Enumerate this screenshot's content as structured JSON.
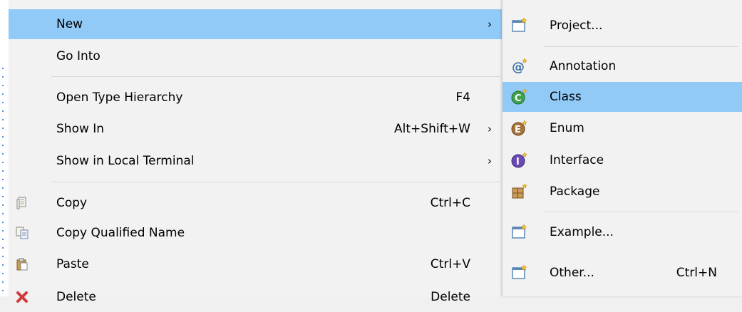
{
  "context_menu": {
    "items": [
      {
        "label": "New",
        "shortcut": "",
        "submenu": true
      },
      {
        "label": "Go Into",
        "shortcut": ""
      },
      {
        "label": "Open Type Hierarchy",
        "shortcut": "F4"
      },
      {
        "label": "Show In",
        "shortcut": "Alt+Shift+W",
        "submenu": true
      },
      {
        "label": "Show in Local Terminal",
        "shortcut": "",
        "submenu": true
      },
      {
        "label": "Copy",
        "shortcut": "Ctrl+C",
        "icon": "copy-icon"
      },
      {
        "label": "Copy Qualified Name",
        "shortcut": "",
        "icon": "copy-qualified-name-icon"
      },
      {
        "label": "Paste",
        "shortcut": "Ctrl+V",
        "icon": "paste-icon"
      },
      {
        "label": "Delete",
        "shortcut": "Delete",
        "icon": "delete-icon"
      }
    ],
    "submenu_arrow": "›"
  },
  "new_submenu": {
    "items": [
      {
        "label": "Project...",
        "shortcut": "",
        "icon": "new-project-icon"
      },
      {
        "label": "Annotation",
        "shortcut": "",
        "icon": "annotation-icon"
      },
      {
        "label": "Class",
        "shortcut": "",
        "icon": "class-icon"
      },
      {
        "label": "Enum",
        "shortcut": "",
        "icon": "enum-icon"
      },
      {
        "label": "Interface",
        "shortcut": "",
        "icon": "interface-icon"
      },
      {
        "label": "Package",
        "shortcut": "",
        "icon": "package-icon"
      },
      {
        "label": "Example...",
        "shortcut": "",
        "icon": "example-icon"
      },
      {
        "label": "Other...",
        "shortcut": "Ctrl+N",
        "icon": "other-wizard-icon"
      }
    ]
  },
  "colors": {
    "highlight": "#91c9f7",
    "menu_bg": "#f2f2f2",
    "separator": "#d7d7d7"
  }
}
